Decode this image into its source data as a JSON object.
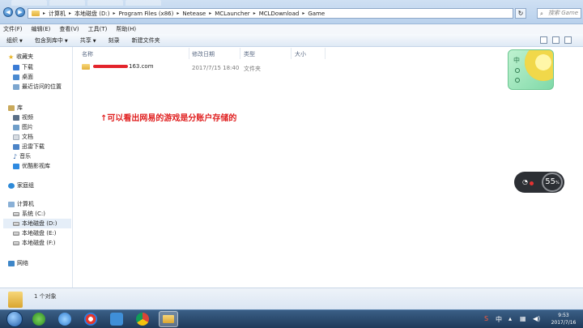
{
  "address": {
    "crumbs": [
      "计算机",
      "本地磁盘 (D:)",
      "Program Files (x86)",
      "Netease",
      "MCLauncher",
      "MCLDownload",
      "Game"
    ]
  },
  "search": {
    "placeholder": "搜索 Game"
  },
  "menu": {
    "items": [
      "文件(F)",
      "编辑(E)",
      "查看(V)",
      "工具(T)",
      "帮助(H)"
    ]
  },
  "toolbar": {
    "organize": "组织",
    "include": "包含到库中",
    "share": "共享",
    "burn": "刻录",
    "new_folder": "新建文件夹"
  },
  "sidebar": {
    "favorites": "收藏夹",
    "fav_items": [
      "下载",
      "桌面",
      "最近访问的位置"
    ],
    "library": "库",
    "lib_items": [
      "视频",
      "图片",
      "文档",
      "迅雷下载",
      "音乐",
      "优酷影视库"
    ],
    "homegroup": "家庭组",
    "computer": "计算机",
    "drives": [
      "系统 (C:)",
      "本地磁盘 (D:)",
      "本地磁盘 (E:)",
      "本地磁盘 (F:)"
    ],
    "network": "网络"
  },
  "columns": {
    "name": "名称",
    "modified": "修改日期",
    "type": "类型",
    "size": "大小"
  },
  "files": [
    {
      "name_suffix": "163.com",
      "modified": "2017/7/15 18:40",
      "type": "文件夹",
      "size": ""
    }
  ],
  "annotation": "↑可以看出网易的游戏是分账户存储的",
  "widget": {
    "chars": [
      "中"
    ]
  },
  "net_meter": {
    "value": "55",
    "unit": "%"
  },
  "status": {
    "count": "1 个对象"
  },
  "clock": {
    "time": "9:53",
    "date": "2017/7/16"
  },
  "colors": {
    "accent": "#2b6fb6",
    "annotation": "#e02020",
    "taskbar": "#1f3a5a"
  }
}
